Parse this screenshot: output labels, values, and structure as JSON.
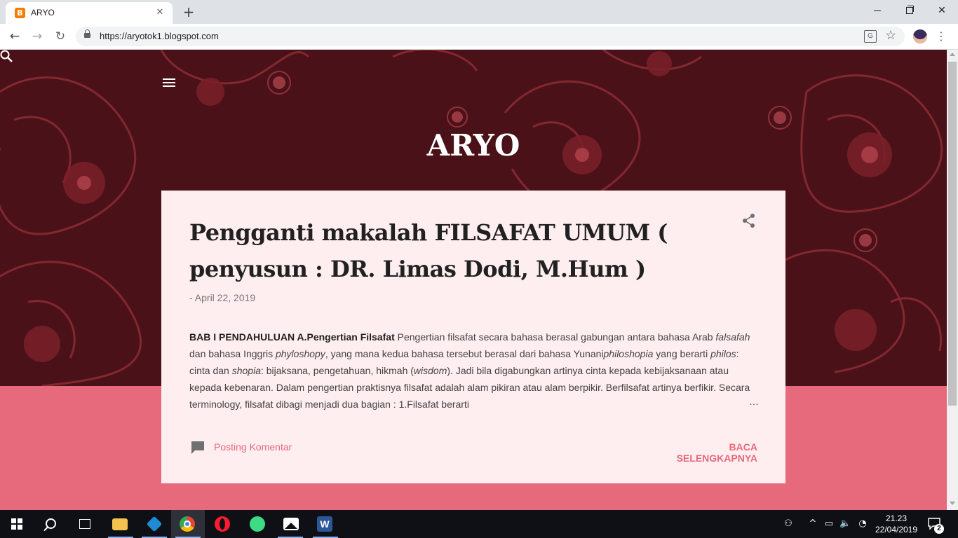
{
  "browser": {
    "tab_title": "ARYO",
    "tab_favicon_letter": "B",
    "url": "https://aryotok1.blogspot.com"
  },
  "blog": {
    "title": "ARYO",
    "accent_color": "#e7697c",
    "header_bg_color": "#4a1218",
    "card_bg_color": "#ffeef0"
  },
  "post": {
    "title": "Pengganti makalah FILSAFAT UMUM ( penyusun : DR. Limas Dodi, M.Hum )",
    "date": "- April 22, 2019",
    "snippet_lead": "BAB I PENDAHULUAN A.Pengertian Filsafat",
    "snippet_parts": [
      " Pengertian filsafat secara bahasa berasal gabungan antara bahasa Arab ",
      "falsafah",
      " dan bahasa Inggris ",
      "phyloshopy",
      ", yang mana kedua bahasa tersebut berasal dari bahasa Yunani",
      "philoshopia",
      " yang berarti ",
      "philos",
      ": cinta dan ",
      "shopia",
      ": bijaksana, pengetahuan, hikmah (",
      "wisdom",
      "). Jadi bila digabungkan artinya cinta kepada kebijaksanaan atau kepada kebenaran. Dalam pengertian praktisnya filsafat adalah alam pikiran atau alam berpikir. Berfilsafat artinya berfikir. Secara terminology, filsafat dibagi menjadi dua bagian : 1.Filsafat berarti"
    ],
    "ellipsis": "…",
    "comment_label": "Posting Komentar",
    "read_more_label": "BACA SELENGKAPNYA"
  },
  "taskbar": {
    "apps": [
      "start",
      "search",
      "task-view",
      "file-explorer",
      "vscode",
      "chrome",
      "opera",
      "android-studio",
      "photos",
      "word"
    ],
    "time": "21.23",
    "date": "22/04/2019",
    "notification_count": "2"
  }
}
